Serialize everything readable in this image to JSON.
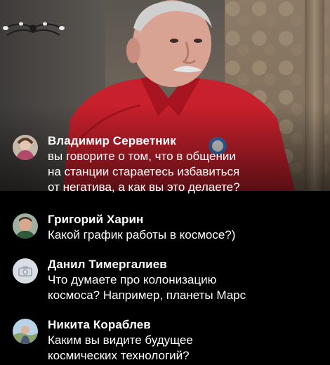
{
  "stream": {
    "comments": [
      {
        "author": "Владимир Серветник",
        "lines": [
          "вы говорите о том, что в общении",
          "на станции стараетесь избавиться",
          "от негатива, а как вы это делаете?"
        ],
        "avatar_icon": "user-photo-avatar"
      },
      {
        "author": "Григорий Харин",
        "lines": [
          "Какой график работы в космосе?)"
        ],
        "avatar_icon": "user-photo-avatar"
      },
      {
        "author": "Данил Тимергалиев",
        "lines": [
          "Что думаете про колонизацию",
          "космоса? Например, планеты Марс"
        ],
        "avatar_icon": "camera-placeholder-icon"
      },
      {
        "author": "Никита Кораблев",
        "lines": [
          "Каким вы видите будущее",
          "космических технологий?"
        ],
        "avatar_icon": "user-photo-avatar"
      }
    ]
  },
  "colors": {
    "background": "#000000",
    "text": "#ffffff",
    "shirt": "#c8202c"
  }
}
